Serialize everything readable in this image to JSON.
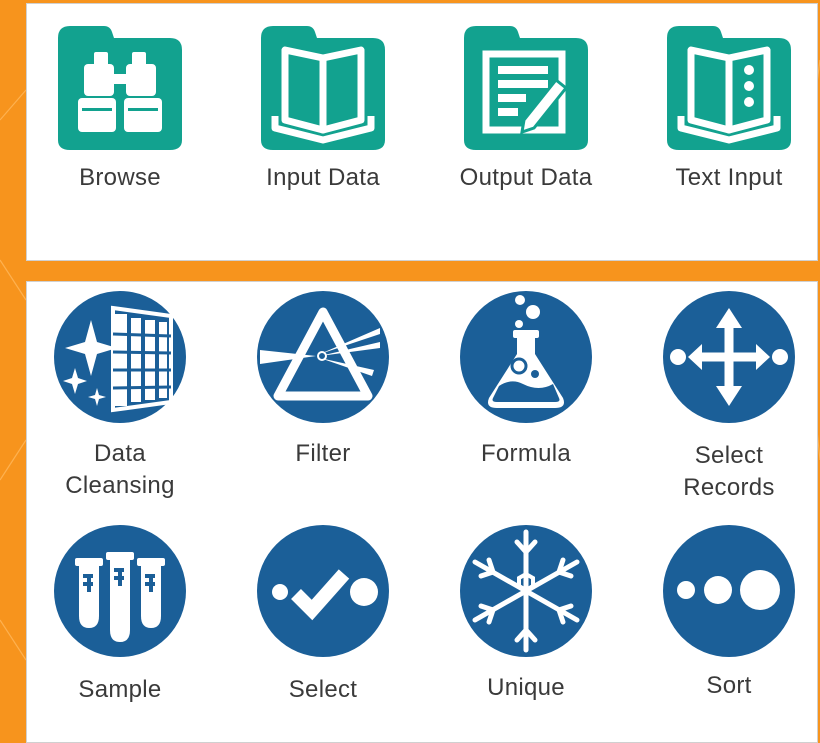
{
  "colors": {
    "background": "#f7941d",
    "io_teal": "#12a28f",
    "prep_blue": "#1b5f98",
    "panel": "#ffffff"
  },
  "io_panel": {
    "tools": [
      {
        "label": "Browse",
        "icon": "binoculars-icon"
      },
      {
        "label": "Input Data",
        "icon": "open-book-icon"
      },
      {
        "label": "Output Data",
        "icon": "document-pencil-icon"
      },
      {
        "label": "Text Input",
        "icon": "book-dots-icon"
      }
    ]
  },
  "prep_panel": {
    "tools": [
      {
        "label": "Data\nCleansing",
        "icon": "sparkle-grid-icon"
      },
      {
        "label": "Filter",
        "icon": "prism-icon"
      },
      {
        "label": "Formula",
        "icon": "flask-icon"
      },
      {
        "label": "Select\nRecords",
        "icon": "four-arrows-icon"
      },
      {
        "label": "Sample",
        "icon": "test-tubes-icon"
      },
      {
        "label": "Select",
        "icon": "checkmark-dots-icon"
      },
      {
        "label": "Unique",
        "icon": "snowflake-icon"
      },
      {
        "label": "Sort",
        "icon": "three-dots-icon"
      }
    ]
  }
}
